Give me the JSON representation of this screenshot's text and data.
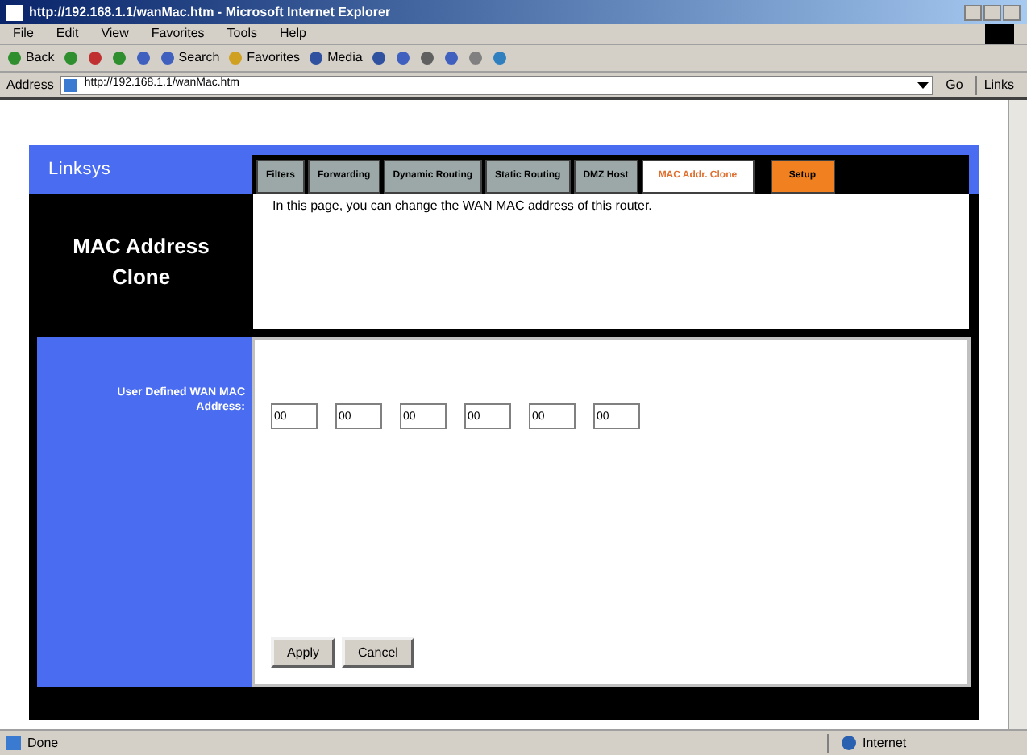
{
  "window": {
    "title": "http://192.168.1.1/wanMac.htm - Microsoft Internet Explorer"
  },
  "menu": [
    "File",
    "Edit",
    "View",
    "Favorites",
    "Tools",
    "Help"
  ],
  "toolbar": [
    {
      "kind": "back",
      "label": "Back"
    },
    {
      "kind": "forward"
    },
    {
      "kind": "stop"
    },
    {
      "kind": "refresh"
    },
    {
      "kind": "home"
    },
    {
      "kind": "search",
      "label": "Search"
    },
    {
      "kind": "favorites",
      "label": "Favorites"
    },
    {
      "kind": "media",
      "label": "Media"
    },
    {
      "kind": "history"
    },
    {
      "kind": "mail"
    },
    {
      "kind": "print"
    },
    {
      "kind": "edit"
    },
    {
      "kind": "discuss"
    },
    {
      "kind": "messenger"
    }
  ],
  "address_bar": {
    "label": "Address",
    "value": "http://192.168.1.1/wanMac.htm",
    "go": "Go",
    "links": "Links"
  },
  "logo": "Linksys",
  "tabs": [
    {
      "label": "Filters",
      "kind": "grey",
      "selected": false
    },
    {
      "label": "Forwarding",
      "kind": "grey",
      "selected": false
    },
    {
      "label": "Dynamic Routing",
      "kind": "grey",
      "selected": false
    },
    {
      "label": "Static Routing",
      "kind": "grey",
      "selected": false
    },
    {
      "label": "DMZ Host",
      "kind": "grey",
      "selected": false
    },
    {
      "label": "MAC Addr. Clone",
      "kind": "grey",
      "selected": true
    },
    {
      "label": "Setup",
      "kind": "orange",
      "selected": false
    }
  ],
  "section_title": "MAC Address Clone",
  "intro": "In this page, you can change the WAN MAC address of this router.",
  "mac_label": "User Defined WAN MAC Address:",
  "mac_fields": [
    "00",
    "00",
    "00",
    "00",
    "00",
    "00"
  ],
  "buttons": [
    "Apply",
    "Cancel"
  ],
  "status_bar": {
    "text": "Done",
    "zone": "Internet"
  }
}
